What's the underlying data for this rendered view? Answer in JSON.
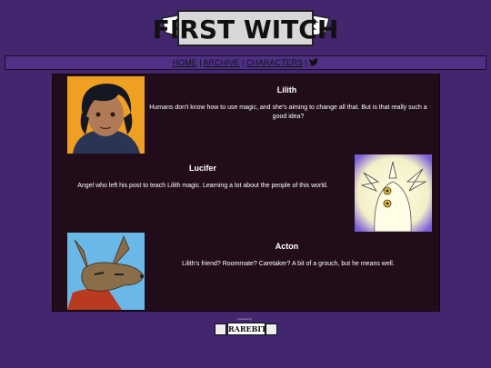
{
  "site": {
    "title": "FIRST WITCH"
  },
  "nav": {
    "items": [
      {
        "label": "HOME"
      },
      {
        "label": "ARCHIVE"
      },
      {
        "label": "CHARACTERS"
      }
    ],
    "separator": "|",
    "twitter_icon": "twitter-bird-icon"
  },
  "characters": [
    {
      "name": "Lilith",
      "description": "Humans don't know how to use magic, and she's aiming to change all that. But is that really such a good idea?"
    },
    {
      "name": "Lucifer",
      "description": "Angel who left his post to teach Lilith magic. Learning a lot about the people of this world."
    },
    {
      "name": "Acton",
      "description": "Lilith's friend? Roommate? Caretaker? A bit of a grouch, but he means well."
    }
  ],
  "footer": {
    "powered_by": "powered by",
    "brand": "RAREBIT"
  },
  "colors": {
    "background": "#42266e",
    "panel": "#210d1a",
    "navbar": "#4f3085"
  }
}
